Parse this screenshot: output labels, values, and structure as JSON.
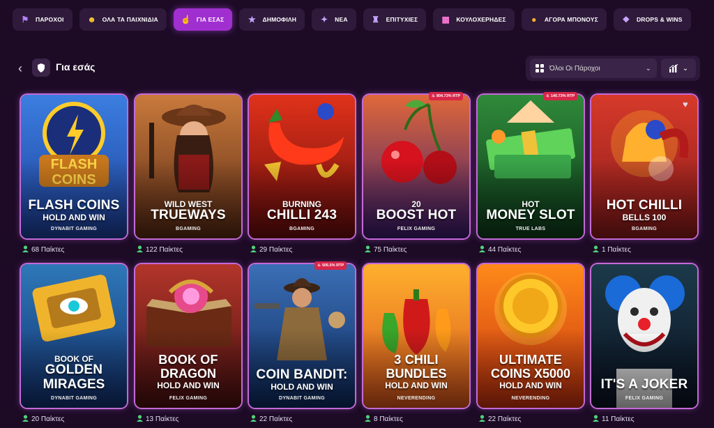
{
  "topnav": [
    {
      "label": "ΠΑΡΟΧΟΙ",
      "icon": "flag-icon",
      "color": "#b483ff"
    },
    {
      "label": "ΟΛΑ ΤΑ ΠΑΙΧΝΙΔΙΑ",
      "icon": "smiley-icon",
      "color": "#ffcf2e"
    },
    {
      "label": "ΓΙΑ ΕΣΑΣ",
      "icon": "finger-pointer-icon",
      "color": "#ffd23c",
      "active": true
    },
    {
      "label": "ΔΗΜΟΦΙΛΗ",
      "icon": "star-icon",
      "color": "#c8a6ff"
    },
    {
      "label": "ΝΕΑ",
      "icon": "sparkle-icon",
      "color": "#c8a6ff"
    },
    {
      "label": "ΕΠΙΤΥΧΙΕΣ",
      "icon": "joystick-icon",
      "color": "#c8a6ff"
    },
    {
      "label": "ΚΟΥΛΟΧΕΡΗΔΕΣ",
      "icon": "slot-machine-icon",
      "color": "#ff7adb"
    },
    {
      "label": "ΑΓΟΡΑ ΜΠΟΝΟΥΣ",
      "icon": "coin-icon",
      "color": "#ffb12e"
    },
    {
      "label": "DROPS & WINS",
      "icon": "gift-icon",
      "color": "#c8a6ff"
    }
  ],
  "page": {
    "title": "Για εσάς",
    "back": "‹"
  },
  "filter": {
    "providers": "Όλοι Οι Πάροχοι"
  },
  "games": [
    {
      "l1": "",
      "l2": "FLASH COINS",
      "l3": "HOLD AND WIN",
      "provider": "DYNABIT GAMING",
      "players": "68 Παίκτες",
      "bg1": "#1d3f9a",
      "bg2": "#3b7ee0",
      "accent": "#ffcc2a",
      "art": "coin"
    },
    {
      "l1": "WILD WEST",
      "l2": "TRUEWAYS",
      "l3": "",
      "provider": "BGAMING",
      "players": "122 Παίκτες",
      "bg1": "#5a2a14",
      "bg2": "#c97a3c",
      "accent": "#d9a56b",
      "art": "cowgirl"
    },
    {
      "l1": "BURNING",
      "l2": "CHILLI 243",
      "l3": "",
      "provider": "BGAMING",
      "players": "29 Παίκτες",
      "bg1": "#6a0c0c",
      "bg2": "#e0321a",
      "accent": "#ff3a1a",
      "art": "chilli"
    },
    {
      "l1": "20",
      "l2": "BOOST HOT",
      "l3": "",
      "provider": "FELIX GAMING",
      "players": "75 Παίκτες",
      "bg1": "#3a1a6e",
      "bg2": "#e0683a",
      "accent": "#d5121e",
      "art": "cherry",
      "rtp": "804.73% RTP"
    },
    {
      "l1": "HOT",
      "l2": "MONEY SLOT",
      "l3": "",
      "provider": "TRUE LABS",
      "players": "44 Παίκτες",
      "bg1": "#0d3a1a",
      "bg2": "#2f8a3a",
      "accent": "#5fd35a",
      "art": "money",
      "rtp": "140.73% RTP"
    },
    {
      "l1": "",
      "l2": "HOT CHILLI",
      "l3": "BELLS 100",
      "provider": "BGAMING",
      "players": "1 Παίκτες",
      "bg1": "#8a1a1a",
      "bg2": "#d63a2a",
      "accent": "#ffb02e",
      "art": "bells",
      "heart": true
    },
    {
      "l1": "BOOK OF",
      "l2": "GOLDEN",
      "l3": "MIRAGES",
      "provider": "DYNABIT GAMING",
      "players": "20 Παίκτες",
      "bg1": "#12306e",
      "bg2": "#2e78b8",
      "accent": "#f0b42c",
      "art": "book",
      "big": true
    },
    {
      "l1": "",
      "l2": "BOOK OF",
      "l3": "DRAGON",
      "provider": "FELIX GAMING",
      "players": "13 Παίκτες",
      "bg1": "#4a1010",
      "bg2": "#b2352a",
      "accent": "#e64a8a",
      "art": "book2",
      "sub": "HOLD AND WIN"
    },
    {
      "l1": "",
      "l2": "COIN BANDIT:",
      "l3": "HOLD AND WIN",
      "provider": "DYNABIT GAMING",
      "players": "22 Παίκτες",
      "bg1": "#0d2a5e",
      "bg2": "#3b6fb6",
      "accent": "#8c6a3c",
      "art": "bandit",
      "rtp": "505.5% RTP"
    },
    {
      "l1": "",
      "l2": "3 CHILI",
      "l3": "BUNDLES",
      "provider": "NEVERENDING",
      "players": "8 Παίκτες",
      "bg1": "#d8541a",
      "bg2": "#ffb02e",
      "accent": "#d01a1a",
      "art": "chilis",
      "sub": "HOLD AND WIN"
    },
    {
      "l1": "",
      "l2": "ULTIMATE",
      "l3": "COINS X5000",
      "provider": "NEVERENDING",
      "players": "22 Παίκτες",
      "bg1": "#c8300e",
      "bg2": "#ff8a1a",
      "accent": "#ffd02a",
      "art": "bigcoin",
      "sub": "HOLD AND WIN"
    },
    {
      "l1": "",
      "l2": "IT'S A JOKER",
      "l3": "",
      "provider": "FELIX GAMING",
      "players": "11 Παίκτες",
      "bg1": "#0a1222",
      "bg2": "#1c3a4a",
      "accent": "#2ab8d8",
      "art": "joker"
    }
  ]
}
